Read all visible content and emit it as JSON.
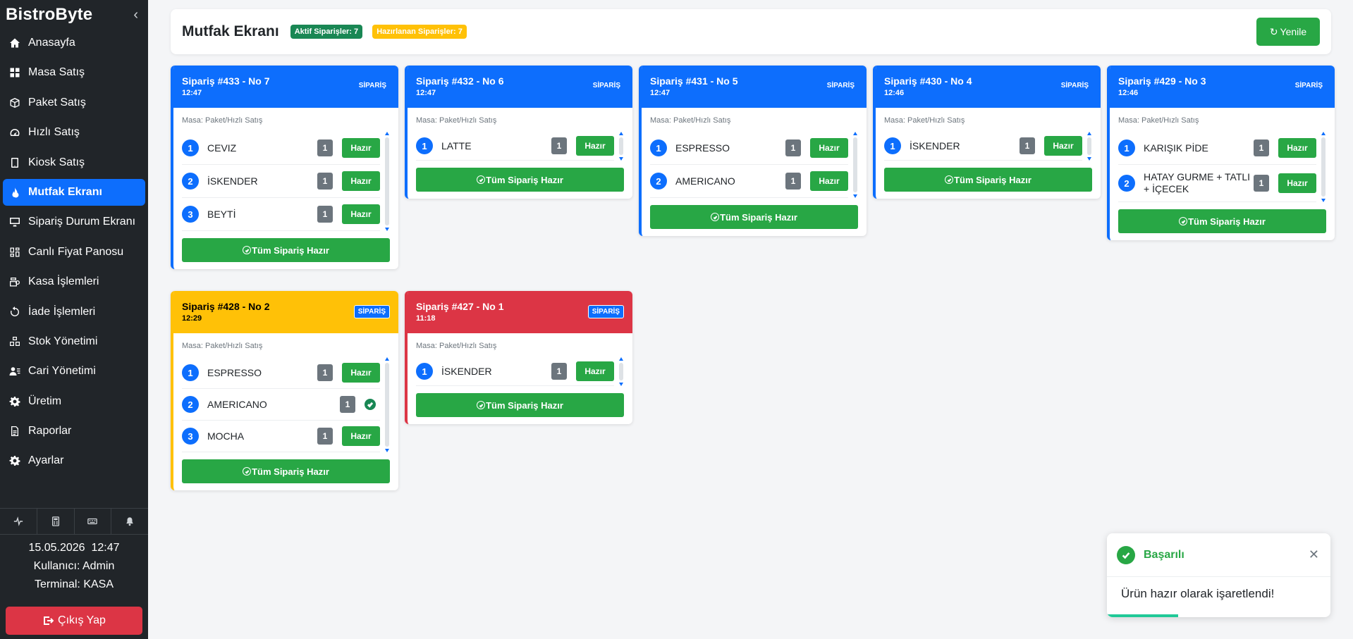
{
  "sidebar": {
    "brand": "BistroByte",
    "items": [
      {
        "label": "Anasayfa",
        "icon": "home-icon"
      },
      {
        "label": "Masa Satış",
        "icon": "grid-icon"
      },
      {
        "label": "Paket Satış",
        "icon": "box-icon"
      },
      {
        "label": "Hızlı Satış",
        "icon": "speedometer-icon"
      },
      {
        "label": "Kiosk Satış",
        "icon": "tablet-icon"
      },
      {
        "label": "Mutfak Ekranı",
        "icon": "fire-icon",
        "active": true
      },
      {
        "label": "Sipariş Durum Ekranı",
        "icon": "monitor-icon"
      },
      {
        "label": "Canlı Fiyat Panosu",
        "icon": "dashboard-icon"
      },
      {
        "label": "Kasa İşlemleri",
        "icon": "cash-register-icon"
      },
      {
        "label": "İade İşlemleri",
        "icon": "undo-icon"
      },
      {
        "label": "Stok Yönetimi",
        "icon": "boxes-icon"
      },
      {
        "label": "Cari Yönetimi",
        "icon": "users-icon"
      },
      {
        "label": "Üretim",
        "icon": "gear-icon"
      },
      {
        "label": "Raporlar",
        "icon": "report-icon"
      },
      {
        "label": "Ayarlar",
        "icon": "settings-icon"
      }
    ],
    "date": "15.05.2026",
    "time": "12:47",
    "user": "Kullanıcı: Admin",
    "terminal": "Terminal: KASA",
    "logout": "Çıkış Yap"
  },
  "header": {
    "title": "Mutfak Ekranı",
    "active_badge": "Aktif Siparişler: 7",
    "preparing_badge": "Hazırlanan Siparişler: 7",
    "refresh": "Yenile"
  },
  "common": {
    "masa": "Masa: Paket/Hızlı Satış",
    "hazir": "Hazır",
    "all_ready": "Tüm Sipariş Hazır",
    "tag": "SİPARİŞ"
  },
  "orders": [
    {
      "title": "Sipariş #433 - No 7",
      "time": "12:47",
      "color": "blue",
      "items": [
        {
          "n": "1",
          "name": "CEVIZ",
          "qty": "1",
          "done": false
        },
        {
          "n": "2",
          "name": "İSKENDER",
          "qty": "1",
          "done": false
        },
        {
          "n": "3",
          "name": "BEYTİ",
          "qty": "1",
          "done": false
        }
      ]
    },
    {
      "title": "Sipariş #432 - No 6",
      "time": "12:47",
      "color": "blue",
      "items": [
        {
          "n": "1",
          "name": "LATTE",
          "qty": "1",
          "done": false
        }
      ]
    },
    {
      "title": "Sipariş #431 - No 5",
      "time": "12:47",
      "color": "blue",
      "items": [
        {
          "n": "1",
          "name": "ESPRESSO",
          "qty": "1",
          "done": false
        },
        {
          "n": "2",
          "name": "AMERICANO",
          "qty": "1",
          "done": false
        }
      ]
    },
    {
      "title": "Sipariş #430 - No 4",
      "time": "12:46",
      "color": "blue",
      "items": [
        {
          "n": "1",
          "name": "İSKENDER",
          "qty": "1",
          "done": false
        }
      ]
    },
    {
      "title": "Sipariş #429 - No 3",
      "time": "12:46",
      "color": "blue",
      "items": [
        {
          "n": "1",
          "name": "KARIŞIK PİDE",
          "qty": "1",
          "done": false
        },
        {
          "n": "2",
          "name": "HATAY GURME + TATLI + İÇECEK",
          "qty": "1",
          "done": false
        }
      ]
    },
    {
      "title": "Sipariş #428 - No 2",
      "time": "12:29",
      "color": "yellow",
      "items": [
        {
          "n": "1",
          "name": "ESPRESSO",
          "qty": "1",
          "done": false
        },
        {
          "n": "2",
          "name": "AMERICANO",
          "qty": "1",
          "done": true
        },
        {
          "n": "3",
          "name": "MOCHA",
          "qty": "1",
          "done": false
        }
      ]
    },
    {
      "title": "Sipariş #427 - No 1",
      "time": "11:18",
      "color": "red",
      "items": [
        {
          "n": "1",
          "name": "İSKENDER",
          "qty": "1",
          "done": false
        }
      ]
    }
  ],
  "toast": {
    "title": "Başarılı",
    "message": "Ürün hazır olarak işaretlendi!",
    "progress": 0.32
  },
  "colors": {
    "primary": "#0d6efd",
    "success": "#28a745",
    "warning": "#ffc107",
    "danger": "#dc3545",
    "sidebar": "#212529"
  }
}
